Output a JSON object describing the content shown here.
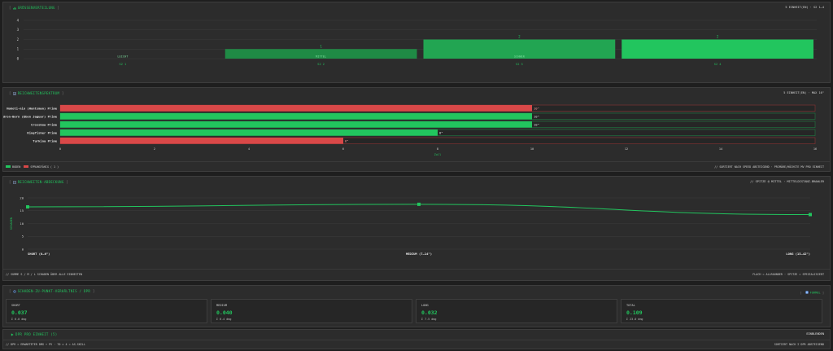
{
  "colors": {
    "green": "#22c55e",
    "red": "#d94848",
    "panel": "#2c2c2c"
  },
  "panel1": {
    "title": "GRÖSSENVERTEILUNG",
    "meta": "5 EINHEIT(EN) · S2 1–4"
  },
  "chart1": {
    "type": "bar",
    "categories": [
      "S2 1",
      "S2 2",
      "S2 3",
      "S2 4"
    ],
    "values": [
      0,
      1,
      2,
      2
    ],
    "value_labels": [
      "",
      "1",
      "2",
      "2"
    ],
    "bar_labels": [
      "LEICHT",
      "MITTEL",
      "SCHWER",
      ""
    ],
    "ylim": [
      0,
      4
    ],
    "yticks": [
      "0",
      "1",
      "2",
      "3",
      "4"
    ]
  },
  "panel2": {
    "title": "REICHWEITENSPEKTRUM",
    "meta": "5 EINHEIT(EN) · MAX 16\"",
    "legend_fast": "BODEN",
    "legend_slow": "SPRUNGFÄHIG ( 1 )",
    "footer_right": "// SORTIERT NACH SPEED ABSTEIGEND · PRIMÄRE/HÖCHSTE MV PRO EINHEIT"
  },
  "chart2": {
    "type": "bar",
    "orientation": "horizontal",
    "categories": [
      "Nakoti-nin (Huntsman) Prime",
      "Cauldron-Born (Ebon Jaguar) Prime",
      "Crossbow Prime",
      "Kingfisher Prime",
      "Turkina Prime"
    ],
    "values": [
      10,
      10,
      10,
      8,
      6
    ],
    "value_labels": [
      "10\"",
      "10\"",
      "10\"",
      "8\"",
      "6\""
    ],
    "status": [
      "slow",
      "fast",
      "fast",
      "fast",
      "slow"
    ],
    "xlim": [
      0,
      16
    ],
    "xticks": [
      "0",
      "2",
      "4",
      "6",
      "8",
      "10",
      "12",
      "14",
      "16"
    ],
    "xlabel": "Zoll"
  },
  "panel3": {
    "title": "REICHWEITEN-ABDECKUNG",
    "meta": "// SPITZE @ MITTEL · MITTELDISTANZ-BRAWLER",
    "footer_left": "// SUMME S / M / L SCHADEN ÜBER ALLE EINHEITEN",
    "footer_right": "FLACH = ALLROUNDER · SPITZE = SPEZIALISIERT"
  },
  "chart3": {
    "type": "line",
    "categories": [
      "SHORT (0–6\")",
      "MEDIUM (7–14\")",
      "LONG (15–42\")"
    ],
    "values": [
      16.5,
      17.5,
      13.5
    ],
    "ylim": [
      0,
      20
    ],
    "yticks": [
      "0",
      "5",
      "10",
      "15",
      "20"
    ],
    "ylabel": "SCHADEN"
  },
  "panel4": {
    "title": "SCHADEN-ZU-PUNKT-VERHÄLTNIS / DPR",
    "action_label": "FORMEL"
  },
  "stats": [
    {
      "label": "SHORT",
      "value": "0.037",
      "sub": "Σ 6.0 dmg"
    },
    {
      "label": "MEDIUM",
      "value": "0.040",
      "sub": "Σ 6.4 dmg"
    },
    {
      "label": "LONG",
      "value": "0.032",
      "sub": "Σ 7.5 dmg"
    },
    {
      "label": "TOTAL",
      "value": "0.109",
      "sub": "Σ 23.0 dmg"
    }
  ],
  "panel5": {
    "title": "DPR PRO EINHEIT (5)",
    "action_label": "EINBLENDEN",
    "footer_left": "// DPR = ERWARTETER DMG ÷ PV · 70 × 4 = AS-SKILL",
    "footer_right": "SORTIERT NACH Σ DPR ABSTEIGEND"
  }
}
